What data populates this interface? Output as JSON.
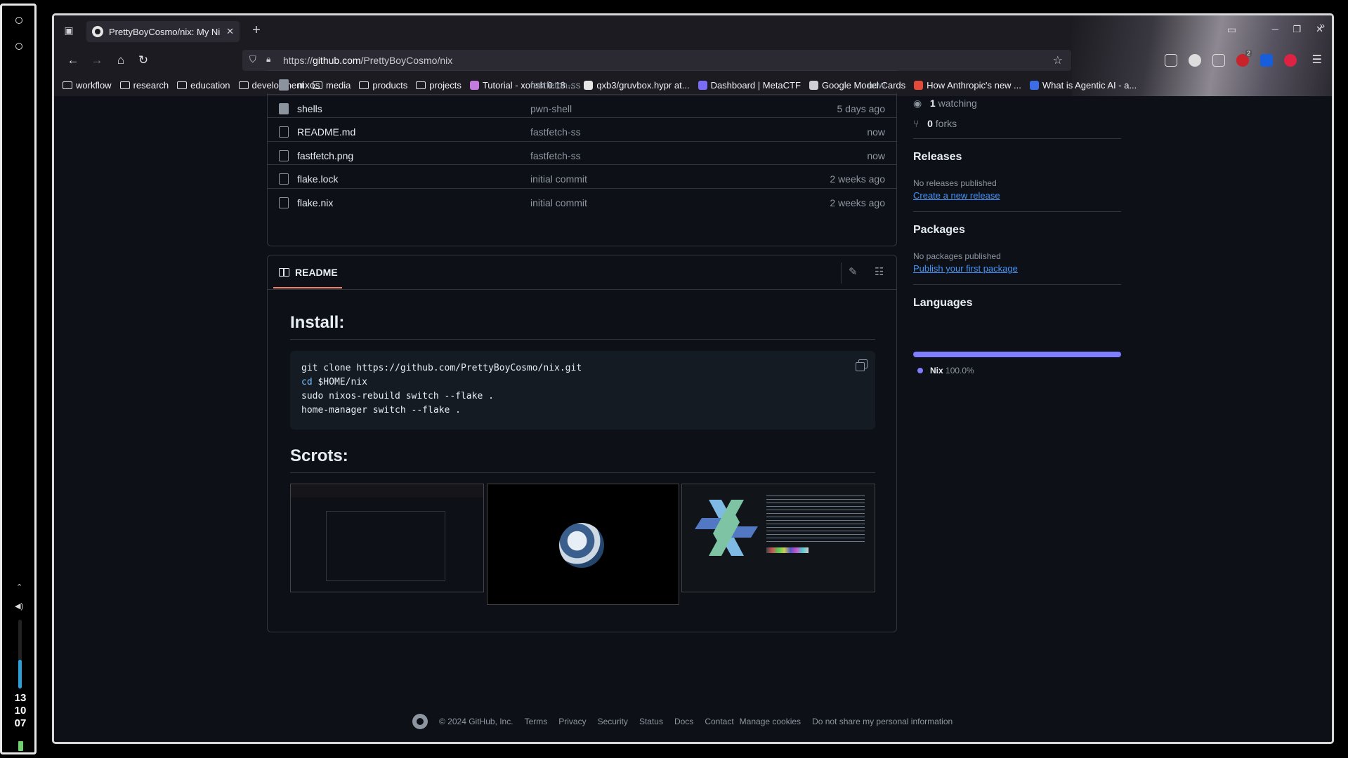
{
  "system": {
    "clock": [
      "13",
      "10",
      "07"
    ]
  },
  "browser": {
    "tab": {
      "title": "PrettyBoyCosmo/nix: My Ni",
      "close": "✕"
    },
    "new_tab": "+",
    "url": {
      "prefix": "https://",
      "host": "github.com",
      "path": "/PrettyBoyCosmo/nix"
    },
    "bookmarks": [
      {
        "label": "workflow",
        "type": "folder"
      },
      {
        "label": "research",
        "type": "folder"
      },
      {
        "label": "education",
        "type": "folder"
      },
      {
        "label": "development",
        "type": "folder"
      },
      {
        "label": "media",
        "type": "folder"
      },
      {
        "label": "products",
        "type": "folder"
      },
      {
        "label": "projects",
        "type": "folder"
      },
      {
        "label": "Tutorial - xonsh 0.18....",
        "type": "link",
        "color": "#c37be0"
      },
      {
        "label": "qxb3/gruvbox.hypr at...",
        "type": "link",
        "color": "#e6e6e6"
      },
      {
        "label": "Dashboard | MetaCTF",
        "type": "link",
        "color": "#7b6cf6"
      },
      {
        "label": "Google Model Cards",
        "type": "link",
        "color": "#cfcfd4"
      },
      {
        "label": "How Anthropic's new ...",
        "type": "link",
        "color": "#e24a3a"
      },
      {
        "label": "What is Agentic AI - a...",
        "type": "link",
        "color": "#3b6ee6"
      }
    ],
    "ext_badge": "2"
  },
  "repo": {
    "files": [
      {
        "name": "nixos",
        "message": "fastfetch-ss",
        "age": "now",
        "type": "folder"
      },
      {
        "name": "shells",
        "message": "pwn-shell",
        "age": "5 days ago",
        "type": "folder"
      },
      {
        "name": "README.md",
        "message": "fastfetch-ss",
        "age": "now",
        "type": "file"
      },
      {
        "name": "fastfetch.png",
        "message": "fastfetch-ss",
        "age": "now",
        "type": "file"
      },
      {
        "name": "flake.lock",
        "message": "initial commit",
        "age": "2 weeks ago",
        "type": "file"
      },
      {
        "name": "flake.nix",
        "message": "initial commit",
        "age": "2 weeks ago",
        "type": "file"
      }
    ],
    "readme": {
      "tab_label": "README",
      "install_heading": "Install:",
      "code_lines": [
        {
          "kw": "",
          "text": "git clone https://github.com/PrettyBoyCosmo/nix.git"
        },
        {
          "kw": "cd",
          "text": " $HOME/nix"
        },
        {
          "kw": "",
          "text": "sudo nixos-rebuild switch --flake ."
        },
        {
          "kw": "",
          "text": "home-manager switch --flake ."
        }
      ],
      "scrots_heading": "Scrots:"
    },
    "sidebar": {
      "watching_count": "1",
      "watching_label": "watching",
      "forks_count": "0",
      "forks_label": "forks",
      "releases_heading": "Releases",
      "releases_none": "No releases published",
      "releases_link": "Create a new release",
      "packages_heading": "Packages",
      "packages_none": "No packages published",
      "packages_link": "Publish your first package",
      "languages_heading": "Languages",
      "language_name": "Nix",
      "language_pct": "100.0%",
      "language_color": "#7e7eff"
    }
  },
  "footer": {
    "copyright": "© 2024 GitHub, Inc.",
    "links": [
      "Terms",
      "Privacy",
      "Security",
      "Status",
      "Docs",
      "Contact",
      "Manage cookies",
      "Do not share my personal information"
    ]
  }
}
